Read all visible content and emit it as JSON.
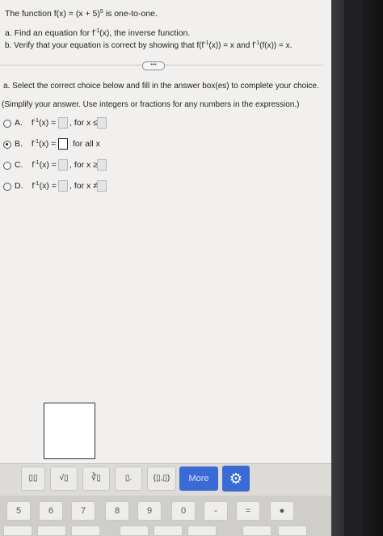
{
  "problem": {
    "statement_pre": "The function f(x) = (x + 5)",
    "statement_exp": "5",
    "statement_post": " is one-to-one.",
    "part_a_label": "a.",
    "part_a_text": "Find an equation for f",
    "part_a_sup": "-1",
    "part_a_text2": "(x), the inverse function.",
    "part_b_label": "b.",
    "part_b_text": "Verify that your equation is correct by showing that f(f",
    "part_b_sup": "-1",
    "part_b_text2": "(x)) = x and f",
    "part_b_sup2": "-1",
    "part_b_text3": "(f(x)) = x.",
    "expand_label": "•••"
  },
  "question": {
    "prompt": "a. Select the correct choice below and fill in the answer box(es) to complete your choice.",
    "hint": "(Simplify your answer. Use integers or fractions for any numbers in the expression.)"
  },
  "choices": [
    {
      "letter": "A.",
      "fn": "f",
      "sup": "-1",
      "lhs": "(x) =",
      "cond": ", for x ≤",
      "selected": false
    },
    {
      "letter": "B.",
      "fn": "f",
      "sup": "-1",
      "lhs": "(x) =",
      "cond": "for all x",
      "selected": true
    },
    {
      "letter": "C.",
      "fn": "f",
      "sup": "-1",
      "lhs": "(x) =",
      "cond": ", for x ≥",
      "selected": false
    },
    {
      "letter": "D.",
      "fn": "f",
      "sup": "-1",
      "lhs": "(x) =",
      "cond": ", for x ≠",
      "selected": false
    }
  ],
  "toolbar": {
    "items": [
      "▯▯",
      "√▯",
      "∛▯",
      "▯.",
      "(▯,▯)"
    ],
    "more_label": "More",
    "settings_icon": "gear-icon"
  },
  "keyboard": {
    "keys": [
      "5",
      "6",
      "7",
      "8",
      "9",
      "0",
      "-",
      "="
    ]
  }
}
